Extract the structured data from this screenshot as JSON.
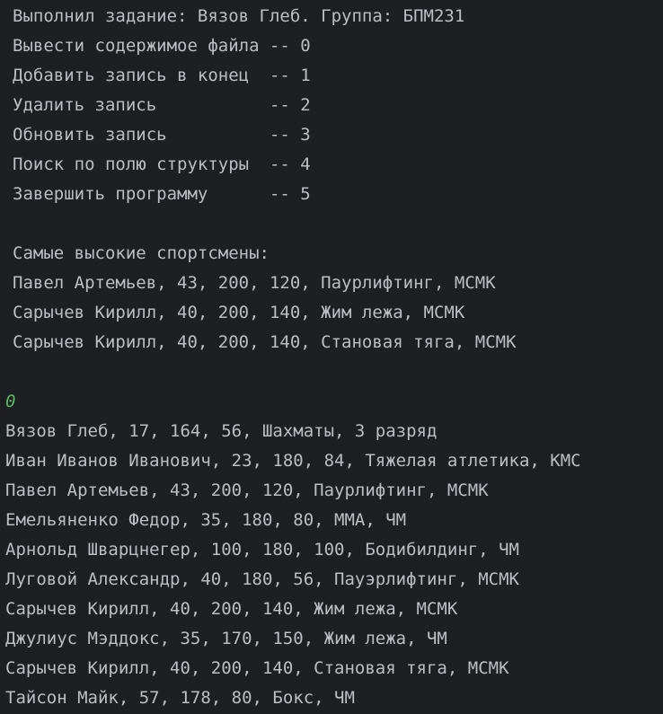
{
  "console": {
    "header": "Выполнил задание: Вязов Глеб. Группа: БПМ231",
    "menu": [
      "Вывести содержимое файла -- 0",
      "Добавить запись в конец  -- 1",
      "Удалить запись           -- 2",
      "Обновить запись          -- 3",
      "Поиск по полю структуры  -- 4",
      "Завершить программу      -- 5"
    ],
    "tallest_title": "Самые высокие спортсмены:",
    "tallest": [
      "Павел Артемьев, 43, 200, 120, Паурлифтинг, МСМК",
      "Сарычев Кирилл, 40, 200, 140, Жим лежа, МСМК",
      "Сарычев Кирилл, 40, 200, 140, Становая тяга, МСМК"
    ],
    "user_input": "0",
    "records": [
      "Вязов Глеб, 17, 164, 56, Шахматы, 3 разряд",
      "Иван Иванов Иванович, 23, 180, 84, Тяжелая атлетика, КМС",
      "Павел Артемьев, 43, 200, 120, Паурлифтинг, МСМК",
      "Емельяненко Федор, 35, 180, 80, ММА, ЧМ",
      "Арнольд Шварцнегер, 100, 180, 100, Бодибилдинг, ЧМ",
      "Луговой Александр, 40, 180, 56, Пауэрлифтинг, МСМК",
      "Сарычев Кирилл, 40, 200, 140, Жим лежа, МСМК",
      "Джулиус Мэддокс, 35, 170, 150, Жим лежа, ЧМ",
      "Сарычев Кирилл, 40, 200, 140, Становая тяга, МСМК",
      "Тайсон Майк, 57, 178, 80, Бокс, ЧМ"
    ]
  }
}
